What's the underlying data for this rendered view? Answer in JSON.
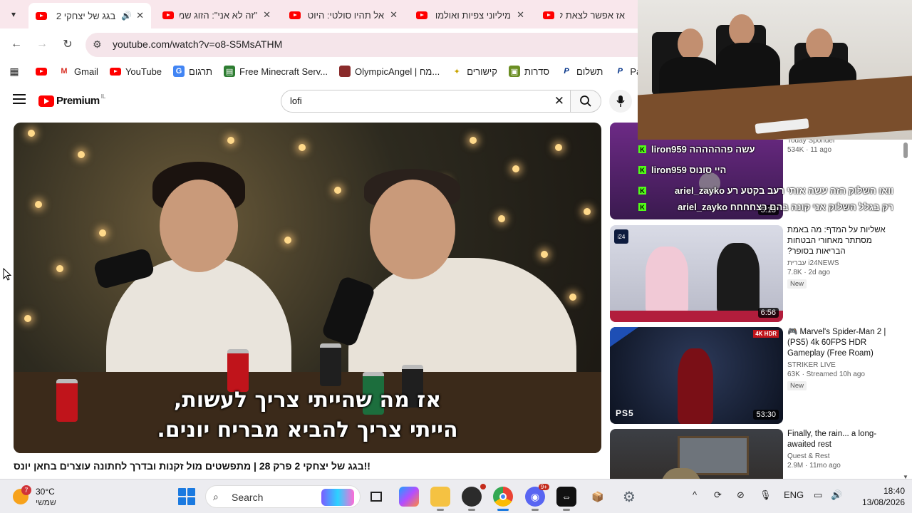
{
  "tabs": [
    {
      "title": "בגג של יצחקי 2",
      "active": true
    },
    {
      "title": "\"זה לא אני\": הזוג שמ",
      "active": false
    },
    {
      "title": "אל תהיו סולטי: היוט",
      "active": false
    },
    {
      "title": "מיליוני צפיות ואולמו",
      "active": false
    },
    {
      "title": "אז אפשר לצאת לפנ",
      "active": false
    }
  ],
  "address": {
    "url": "youtube.com/watch?v=o8-S5MsATHM"
  },
  "bookmarks": [
    {
      "label": "Gmail"
    },
    {
      "label": "YouTube"
    },
    {
      "label": "תרגום"
    },
    {
      "label": "Free Minecraft Serv..."
    },
    {
      "label": "OlympicAngel | מח..."
    },
    {
      "label": "קישורים"
    },
    {
      "label": "סדרות"
    },
    {
      "label": "תשלום"
    },
    {
      "label": "Payl"
    }
  ],
  "yt": {
    "logo_word": "Premium",
    "country": "IL",
    "search_query": "lofi"
  },
  "player": {
    "subtitle_line1": "אז מה שהייתי צריך לעשות,",
    "subtitle_line2": "הייתי צריך להביא מבריח יונים."
  },
  "video_title": "!!בגג של יצחקי 2 פרק 28 | מתפשטים מול זקנות ובדרך לחתונה עוצרים בחאן יונס",
  "recommendations": [
    {
      "title": "",
      "channel": "Today Sponder",
      "stats": "534K · 11 ago",
      "duration": "5:13",
      "badge": "",
      "chat": [
        {
          "user": "liron959",
          "msg": "עשה פהההההה"
        },
        {
          "user": "liron959",
          "msg": "היי סונוס"
        },
        {
          "user": "ariel_zayko",
          "msg": "וואו השלוק הזה עשה אותי רעב בקטע רע"
        },
        {
          "user": "ariel_zayko",
          "msg": "רק בגלל השלוק אני קונה בהם רצחחחח"
        }
      ]
    },
    {
      "title": "אשליות על המדף: מה באמת מסתתר מאחורי הבטחות הבריאות בסופר?",
      "channel": "i24NEWS עברית",
      "stats": "7.8K · 2d ago",
      "duration": "6:56",
      "badge": "New"
    },
    {
      "title": "🎮 Marvel's Spider-Man 2 | (PS5) 4k 60FPS HDR Gameplay (Free Roam)",
      "channel": "STRIKER LIVE",
      "stats": "63K · Streamed 10h ago",
      "duration": "53:30",
      "badge": "New"
    },
    {
      "title": "Finally, the rain... a long-awaited rest",
      "channel": "Quest & Rest",
      "stats": "2.9M · 11mo ago",
      "duration": "",
      "badge": ""
    }
  ],
  "thumb_labels": {
    "news_logo": "i24",
    "hdr_badge": "4K HDR",
    "ps5": "PS5"
  },
  "taskbar": {
    "weather_temp": "30°C",
    "weather_cond": "שמשי",
    "weather_alert": "7",
    "search_label": "Search",
    "discord_badge": "9+",
    "lang": "ENG",
    "time": "18:40",
    "date": "13/08/2026"
  },
  "colors": {
    "brand_red": "#ff0000",
    "tab_strip": "#f9e7ec",
    "kick_green": "#53fc18"
  }
}
